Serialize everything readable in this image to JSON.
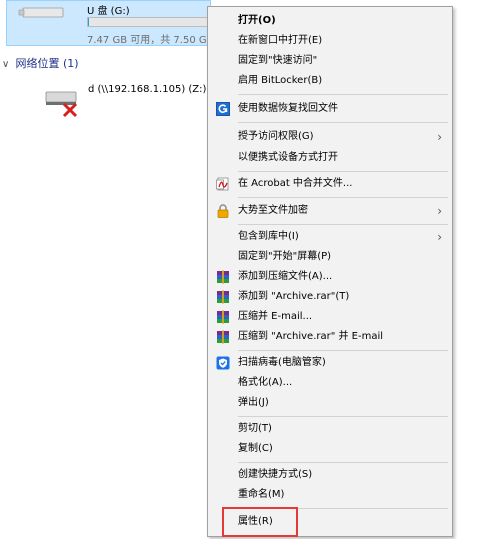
{
  "drive": {
    "name": "U 盘 (G:)",
    "free_text": "7.47 GB 可用，共 7.50 G",
    "used_fraction": 0.004
  },
  "network_section": {
    "title": "网络位置 (1)"
  },
  "network_drive": {
    "name": "d (\\\\192.168.1.105) (Z:)"
  },
  "menu": {
    "open": "打开(O)",
    "open_new_window": "在新窗口中打开(E)",
    "pin_quick_access": "固定到\"快速访问\"",
    "enable_bitlocker": "启用 BitLocker(B)",
    "data_recovery": "使用数据恢复找回文件",
    "grant_access": "授予访问权限(G)",
    "portable_device": "以便携式设备方式打开",
    "acrobat_merge": "在 Acrobat 中合并文件...",
    "encrypt": "大势至文件加密",
    "include_library": "包含到库中(I)",
    "pin_start": "固定到\"开始\"屏幕(P)",
    "add_archive": "添加到压缩文件(A)...",
    "add_archive_rar": "添加到 \"Archive.rar\"(T)",
    "compress_email": "压缩并 E-mail...",
    "compress_rar_email": "压缩到 \"Archive.rar\" 并 E-mail",
    "scan_virus": "扫描病毒(电脑管家)",
    "format": "格式化(A)...",
    "eject": "弹出(J)",
    "cut": "剪切(T)",
    "copy": "复制(C)",
    "create_shortcut": "创建快捷方式(S)",
    "rename": "重命名(M)",
    "properties": "属性(R)"
  },
  "icons": {
    "usb": "usb-drive-icon",
    "network": "network-drive-disconnected-icon",
    "recovery": "data-recovery-icon",
    "acrobat": "acrobat-icon",
    "lock": "lock-icon",
    "winrar": "winrar-icon",
    "shield": "security-shield-icon"
  },
  "colors": {
    "menu_bg": "#f2f2f2",
    "selection_bg": "#cce8ff",
    "highlight_box": "#e53935",
    "section_title": "#1e3287",
    "usage_bar": "#26a0da"
  }
}
